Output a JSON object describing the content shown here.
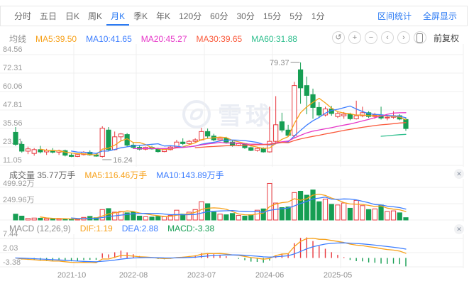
{
  "toolbar": {
    "tabs": [
      {
        "label": "分时",
        "active": false
      },
      {
        "label": "五日",
        "active": false
      },
      {
        "label": "日K",
        "active": false
      },
      {
        "label": "周K",
        "active": false
      },
      {
        "label": "月K",
        "active": true
      },
      {
        "label": "季K",
        "active": false
      },
      {
        "label": "年K",
        "active": false
      },
      {
        "label": "120分",
        "active": false
      },
      {
        "label": "60分",
        "active": false
      },
      {
        "label": "30分",
        "active": false
      },
      {
        "label": "15分",
        "active": false
      },
      {
        "label": "5分",
        "active": false
      },
      {
        "label": "1分",
        "active": false
      }
    ],
    "links": {
      "range_stat": "区间统计",
      "fullscreen": "全屏显示"
    }
  },
  "price_panel": {
    "legend": {
      "label": "均线",
      "ma5": "MA5:39.50",
      "ma10": "MA10:41.65",
      "ma20": "MA20:45.27",
      "ma30": "MA30:39.65",
      "ma60": "MA60:31.88"
    },
    "controls": {
      "undo": "↺",
      "zoom_in": "+",
      "zoom_out": "−",
      "prev": "‹",
      "next": "›",
      "adjustment": "前复权"
    },
    "y_labels": [
      "84.56",
      "72.31",
      "60.06",
      "47.81",
      "35.56",
      "23.31",
      "11.05"
    ],
    "annotations": {
      "high": "79.37",
      "low": "16.24"
    }
  },
  "volume_panel": {
    "title": "成交量 35.77万手",
    "ma5": "MA5:116.46万手",
    "ma10": "MA10:143.89万手",
    "y_labels": [
      "499.92万",
      "249.96万"
    ],
    "close": "✕"
  },
  "macd_panel": {
    "title": "MACD (12,26,9)",
    "dif": "DIF:1.19",
    "dea": "DEA:2.88",
    "macd": "MACD:-3.38",
    "y_labels": [
      "7.44",
      "2.03",
      "-3.38"
    ],
    "close": "✕"
  },
  "watermark": "雪球",
  "colors": {
    "up": "#e8393f",
    "down": "#169e53",
    "ma5": "#f7a11a",
    "ma10": "#3d7eff",
    "ma20": "#e637c8",
    "ma30": "#fa5a3c",
    "ma60": "#2dbe8d",
    "accent": "#2c7bf4",
    "grid": "#efefef",
    "tick": "#9b9b9b",
    "annotation": "#8c8c8c"
  },
  "chart_data": {
    "type": "candlestick",
    "period": "monthly",
    "price_grid_values": [
      84.56,
      72.31,
      60.06,
      47.81,
      35.56,
      23.31,
      11.05
    ],
    "volume_grid_values_wan": [
      499.92,
      249.96
    ],
    "macd_grid_values": [
      7.44,
      2.03,
      -3.38
    ],
    "high_annotation": 79.37,
    "low_annotation": 16.24,
    "x_ticks": [
      {
        "label": "2021-10",
        "index": 9
      },
      {
        "label": "2022-08",
        "index": 19
      },
      {
        "label": "2023-07",
        "index": 30
      },
      {
        "label": "2024-06",
        "index": 41
      },
      {
        "label": "2025-05",
        "index": 52
      }
    ],
    "ohlc": [
      [
        33.0,
        36.5,
        24.0,
        25.0
      ],
      [
        25.0,
        27.0,
        19.5,
        20.5
      ],
      [
        20.5,
        23.5,
        18.5,
        22.0
      ],
      [
        19.0,
        22.5,
        17.5,
        21.5
      ],
      [
        21.5,
        24.0,
        19.0,
        20.0
      ],
      [
        20.0,
        22.0,
        18.0,
        21.0
      ],
      [
        21.0,
        22.5,
        19.0,
        19.8
      ],
      [
        19.8,
        21.5,
        18.0,
        20.8
      ],
      [
        20.8,
        21.5,
        17.0,
        17.8
      ],
      [
        17.8,
        19.0,
        16.5,
        17.0
      ],
      [
        17.0,
        18.8,
        16.6,
        18.2
      ],
      [
        18.2,
        20.5,
        17.6,
        19.8
      ],
      [
        19.8,
        21.0,
        17.4,
        18.0
      ],
      [
        18.0,
        19.0,
        16.8,
        17.2
      ],
      [
        17.0,
        37.0,
        16.24,
        35.7
      ],
      [
        34.5,
        36.5,
        20.5,
        21.5
      ],
      [
        21.5,
        33.5,
        21.0,
        30.0
      ],
      [
        30.0,
        32.5,
        27.0,
        31.9
      ],
      [
        31.5,
        32.5,
        23.5,
        24.5
      ],
      [
        24.5,
        26.5,
        22.0,
        23.0
      ],
      [
        23.0,
        24.0,
        21.0,
        21.8
      ],
      [
        21.8,
        23.5,
        21.0,
        23.0
      ],
      [
        23.0,
        24.0,
        21.5,
        22.0
      ],
      [
        22.0,
        22.8,
        19.5,
        20.2
      ],
      [
        20.2,
        22.0,
        19.8,
        21.5
      ],
      [
        21.5,
        24.0,
        21.0,
        23.2
      ],
      [
        23.2,
        28.0,
        22.5,
        26.5
      ],
      [
        26.5,
        29.0,
        24.5,
        25.5
      ],
      [
        25.5,
        28.0,
        24.8,
        27.0
      ],
      [
        27.0,
        29.0,
        26.0,
        28.0
      ],
      [
        28.0,
        36.0,
        27.5,
        33.5
      ],
      [
        33.5,
        35.5,
        29.0,
        30.5
      ],
      [
        30.5,
        32.0,
        27.0,
        28.0
      ],
      [
        28.0,
        30.0,
        27.0,
        29.0
      ],
      [
        29.0,
        30.0,
        25.5,
        26.5
      ],
      [
        26.5,
        27.5,
        23.5,
        24.2
      ],
      [
        24.2,
        26.0,
        23.8,
        25.5
      ],
      [
        25.5,
        26.0,
        22.0,
        22.8
      ],
      [
        22.8,
        23.5,
        20.5,
        21.0
      ],
      [
        21.0,
        23.0,
        20.2,
        22.3
      ],
      [
        22.3,
        23.0,
        19.5,
        20.0
      ],
      [
        20.0,
        50.0,
        19.5,
        27.0
      ],
      [
        27.0,
        57.0,
        25.0,
        38.0
      ],
      [
        40.0,
        46.0,
        33.0,
        34.5
      ],
      [
        34.5,
        38.0,
        30.0,
        31.0
      ],
      [
        31.0,
        66.5,
        29.5,
        64.0
      ],
      [
        74.5,
        79.37,
        52.0,
        62.5
      ],
      [
        64.0,
        70.0,
        45.0,
        57.5
      ],
      [
        58.0,
        62.0,
        42.0,
        49.5
      ],
      [
        49.5,
        53.0,
        43.0,
        44.5
      ],
      [
        44.5,
        50.0,
        43.5,
        48.5
      ],
      [
        48.5,
        50.5,
        44.0,
        45.5
      ],
      [
        43.5,
        47.0,
        42.5,
        45.5
      ],
      [
        44.0,
        46.5,
        42.0,
        45.0
      ],
      [
        45.0,
        46.0,
        41.0,
        42.0
      ],
      [
        42.0,
        54.0,
        41.5,
        44.0
      ],
      [
        44.0,
        50.0,
        43.0,
        46.0
      ],
      [
        46.0,
        47.0,
        42.5,
        43.5
      ],
      [
        43.5,
        46.0,
        42.0,
        44.5
      ],
      [
        44.5,
        50.0,
        41.5,
        42.5
      ],
      [
        42.5,
        44.5,
        41.0,
        43.0
      ],
      [
        43.0,
        47.0,
        42.0,
        44.0
      ],
      [
        44.0,
        45.0,
        41.0,
        41.8
      ],
      [
        41.5,
        42.5,
        34.0,
        35.5
      ]
    ],
    "volume_wan": [
      90,
      60,
      25,
      30,
      28,
      22,
      18,
      15,
      14,
      12,
      13,
      40,
      55,
      35,
      160,
      175,
      120,
      130,
      110,
      120,
      60,
      50,
      45,
      55,
      50,
      70,
      150,
      90,
      120,
      160,
      280,
      250,
      120,
      90,
      80,
      100,
      70,
      60,
      80,
      150,
      170,
      560,
      260,
      190,
      200,
      420,
      440,
      380,
      460,
      280,
      320,
      240,
      230,
      260,
      180,
      300,
      220,
      160,
      170,
      230,
      130,
      140,
      110,
      36
    ]
  }
}
